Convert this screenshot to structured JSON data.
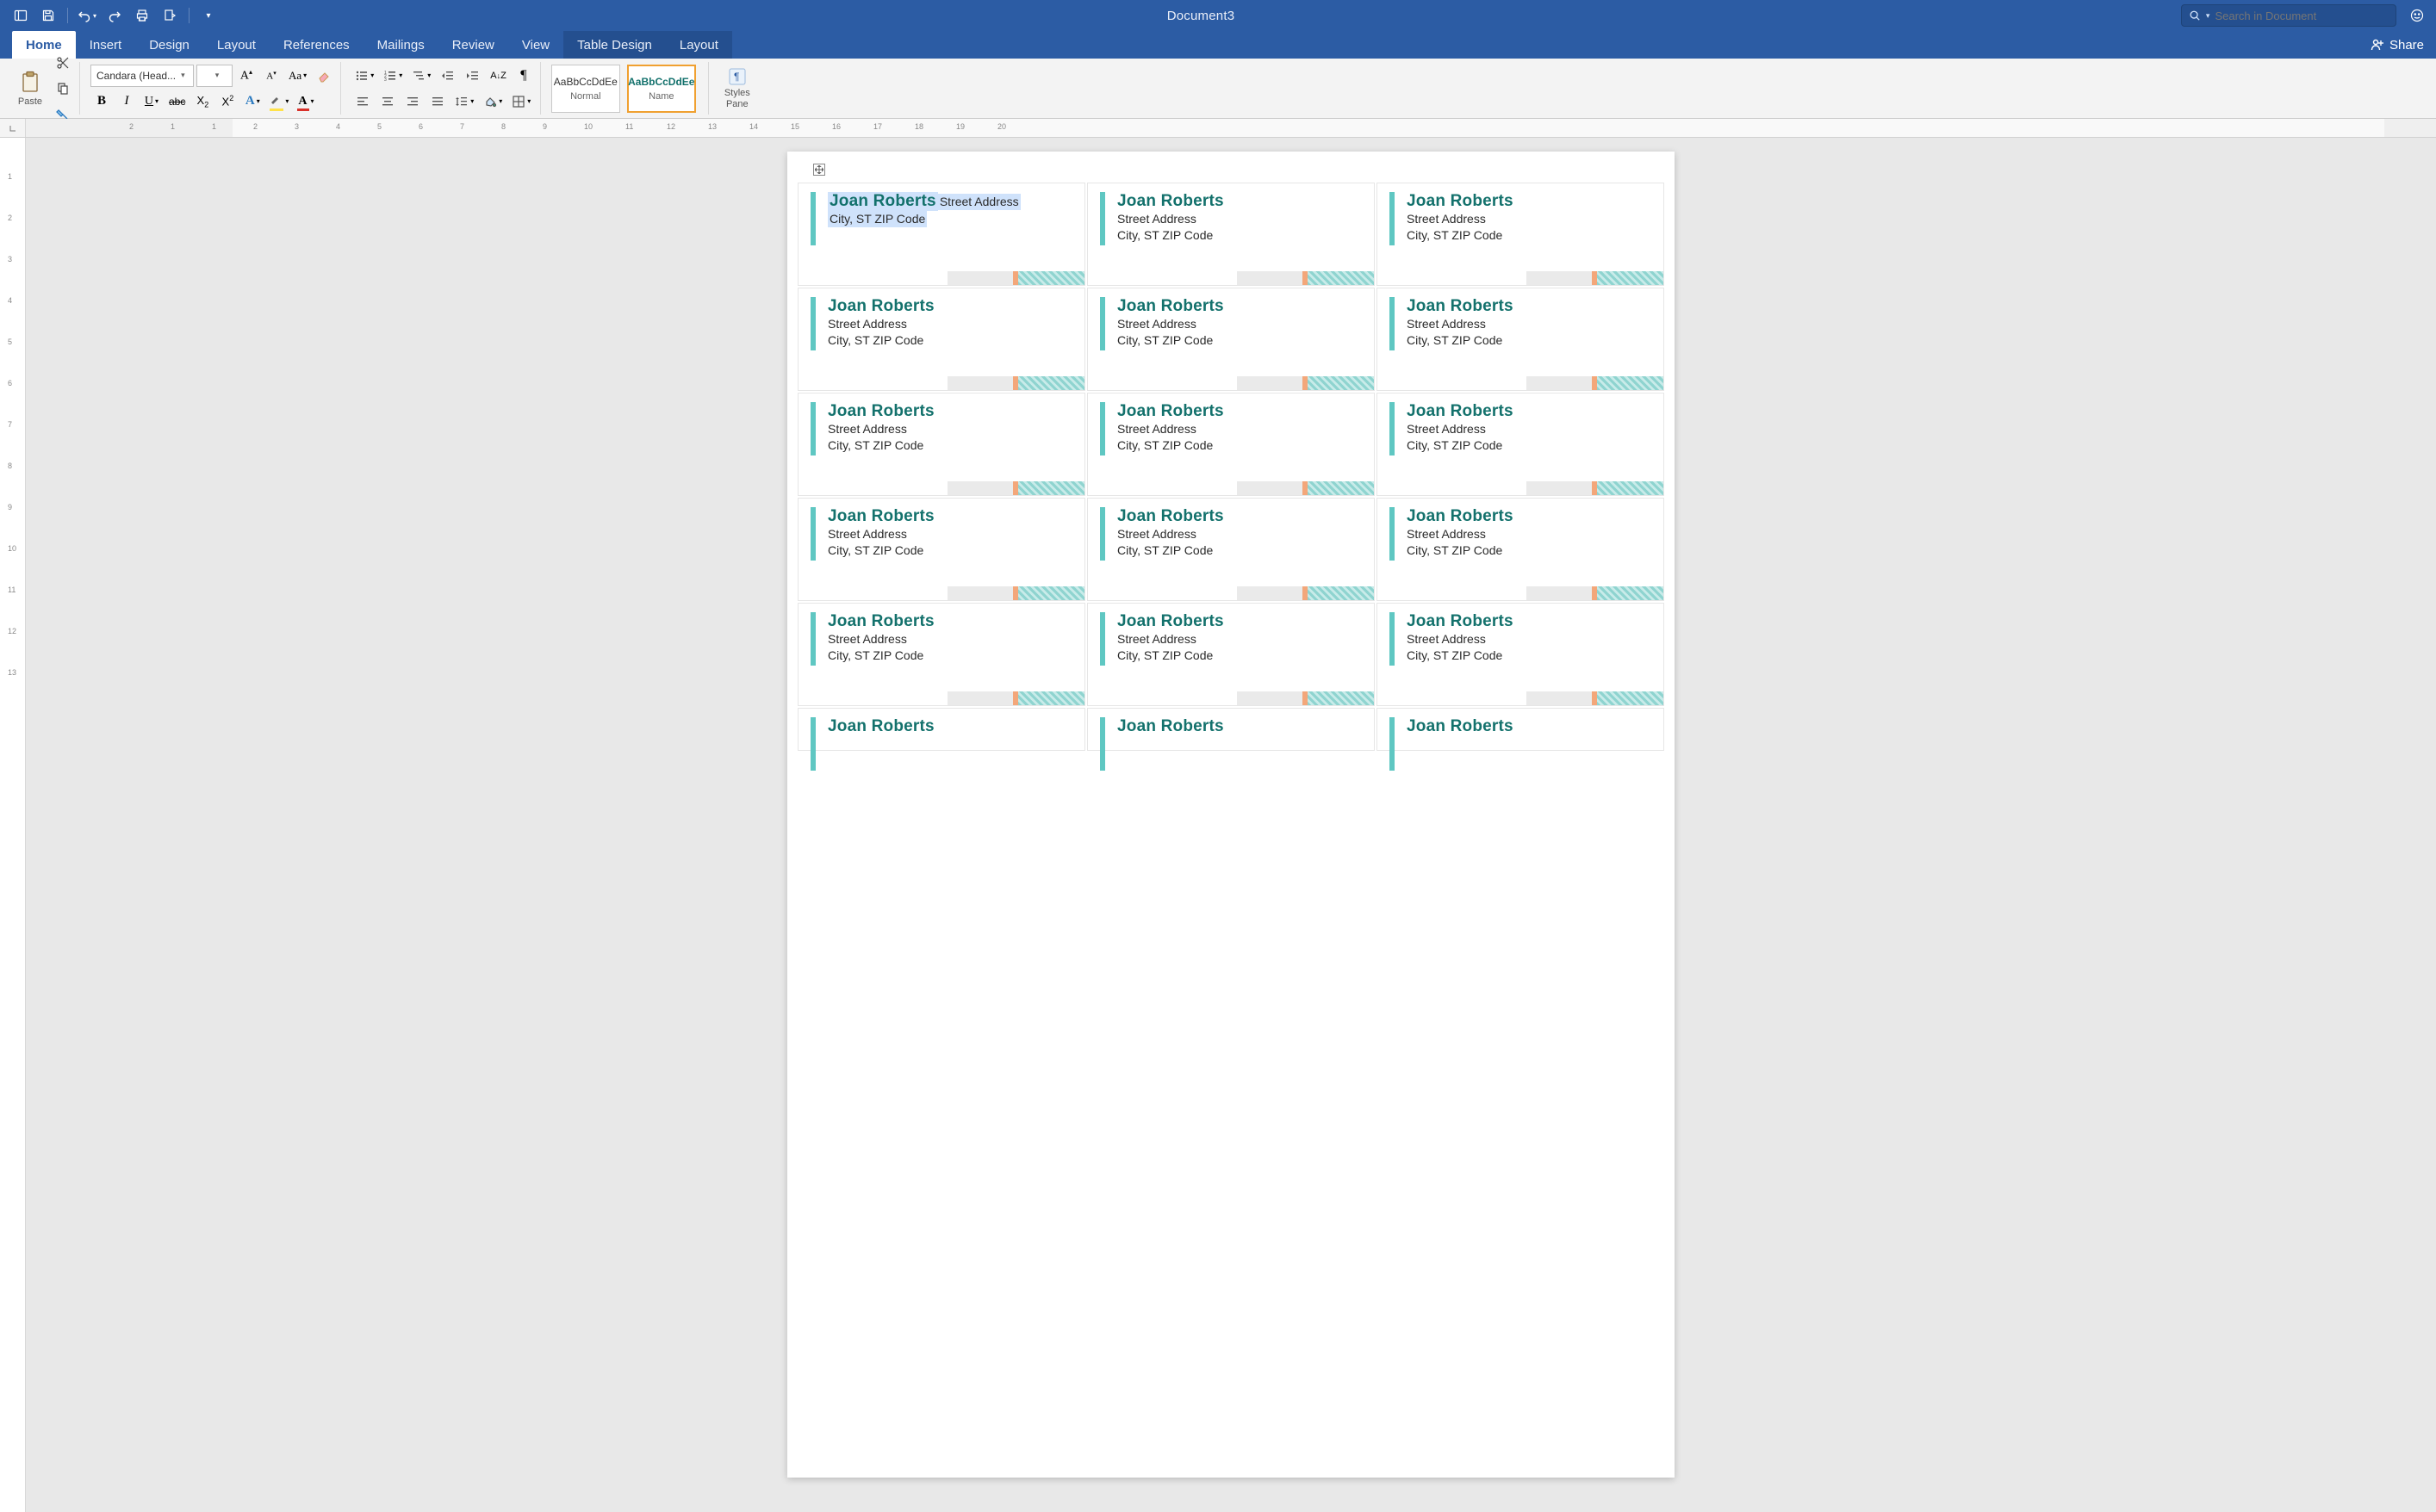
{
  "title_bar": {
    "document_title": "Document3",
    "search_placeholder": "Search in Document"
  },
  "tabs": {
    "home": "Home",
    "insert": "Insert",
    "design": "Design",
    "layout": "Layout",
    "references": "References",
    "mailings": "Mailings",
    "review": "Review",
    "view": "View",
    "table_design": "Table Design",
    "table_layout": "Layout",
    "share": "Share"
  },
  "ribbon": {
    "paste_label": "Paste",
    "font_name": "Candara (Head...",
    "font_size": "",
    "styles_pane": "Styles\nPane",
    "style_normal_sample": "AaBbCcDdEe",
    "style_normal_name": "Normal",
    "style_name_sample": "AaBbCcDdEe",
    "style_name_name": "Name"
  },
  "ruler": {
    "h_numbers": [
      "2",
      "1",
      "1",
      "2",
      "3",
      "4",
      "5",
      "6",
      "7",
      "8",
      "9",
      "10",
      "11",
      "12",
      "13",
      "14",
      "15",
      "16",
      "17",
      "18",
      "19",
      "20"
    ],
    "v_numbers": [
      "1",
      "2",
      "3",
      "4",
      "5",
      "6",
      "7",
      "8",
      "9",
      "10",
      "11",
      "12",
      "13"
    ]
  },
  "label_template": {
    "name": "Joan Roberts",
    "street": "Street Address",
    "city": "City, ST ZIP Code"
  },
  "colors": {
    "brand": "#2c5ca4",
    "accent_teal": "#13716c",
    "accent_bar": "#5fc7c2"
  }
}
